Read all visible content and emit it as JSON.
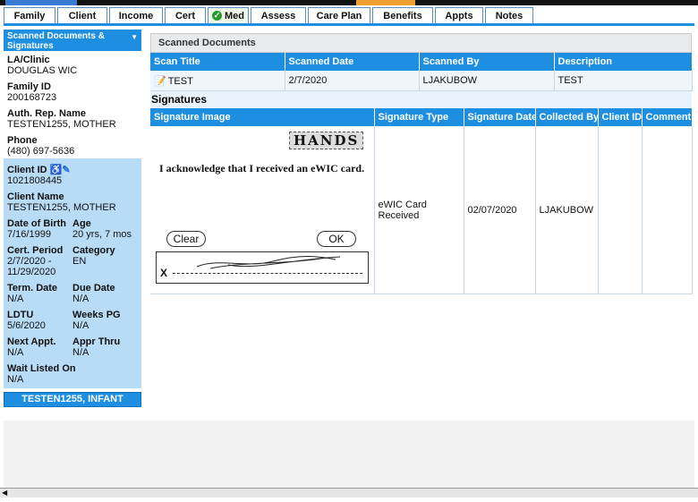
{
  "tabs": [
    {
      "label": "Family",
      "w": 58
    },
    {
      "label": "Client",
      "w": 56
    },
    {
      "label": "Income",
      "w": 60
    },
    {
      "label": "Cert",
      "w": 46
    },
    {
      "label": "Med",
      "w": 46,
      "checked": true
    },
    {
      "label": "Assess",
      "w": 62
    },
    {
      "label": "Care Plan",
      "w": 70
    },
    {
      "label": "Benefits",
      "w": 68
    },
    {
      "label": "Appts",
      "w": 54
    },
    {
      "label": "Notes",
      "w": 54
    }
  ],
  "sidebar": {
    "header": "Scanned Documents & Signatures",
    "la_label": "LA/Clinic",
    "la_value": "DOUGLAS WIC",
    "family_label": "Family ID",
    "family_value": "200168723",
    "auth_label": "Auth. Rep. Name",
    "auth_value": "TESTEN1255, MOTHER",
    "phone_label": "Phone",
    "phone_value": "(480) 697-5636",
    "client_id_label": "Client ID",
    "client_id_value": "1021808445",
    "client_name_label": "Client Name",
    "client_name_value": "TESTEN1255, MOTHER",
    "dob_label": "Date of Birth",
    "dob_value": "7/16/1999",
    "age_label": "Age",
    "age_value": "20 yrs, 7 mos",
    "cert_label": "Cert. Period",
    "cert_value": "2/7/2020 - 11/29/2020",
    "cat_label": "Category",
    "cat_value": "EN",
    "term_label": "Term. Date",
    "term_value": "N/A",
    "due_label": "Due Date",
    "due_value": "N/A",
    "ldtu_label": "LDTU",
    "ldtu_value": "5/6/2020",
    "weeks_label": "Weeks PG",
    "weeks_value": "N/A",
    "next_label": "Next Appt.",
    "next_value": "N/A",
    "appr_label": "Appr Thru",
    "appr_value": "N/A",
    "wait_label": "Wait Listed On",
    "wait_value": "N/A",
    "footer": "TESTEN1255, INFANT"
  },
  "scanned": {
    "title": "Scanned Documents",
    "columns": [
      "Scan Title",
      "Scanned Date",
      "Scanned By",
      "Description"
    ],
    "row": {
      "title": "TEST",
      "date": "2/7/2020",
      "by": "LJAKUBOW",
      "desc": "TEST"
    }
  },
  "signatures": {
    "title": "Signatures",
    "columns": [
      "Signature Image",
      "Signature Type",
      "Signature Date",
      "Collected By",
      "Client ID",
      "Comment"
    ],
    "row": {
      "type": "eWIC Card Received",
      "date": "02/07/2020",
      "by": "LJAKUBOW",
      "client_id": "",
      "comment": ""
    },
    "image": {
      "logo": "HANDS",
      "ack": "I acknowledge that I received an eWIC card.",
      "clear": "Clear",
      "ok": "OK",
      "x": "X"
    }
  }
}
